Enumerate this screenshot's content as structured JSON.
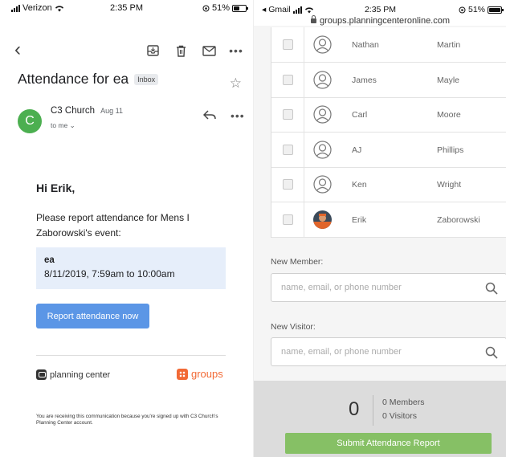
{
  "gmail": {
    "status": {
      "carrier": "Verizon",
      "time": "2:35 PM",
      "battery": "51%"
    },
    "toolbar": {
      "archive_icon": "archive-icon",
      "delete_icon": "trash-icon",
      "mail_icon": "mail-icon",
      "more_icon": "more-icon"
    },
    "subject": "Attendance for ea",
    "label_badge": "Inbox",
    "sender": {
      "initial": "C",
      "name": "C3 Church",
      "date": "Aug 11",
      "to": "to me ⌄",
      "avatar_color": "#4caf50"
    },
    "body": {
      "greeting": "Hi Erik,",
      "message": "Please report attendance for Mens I Zaborowski's event:",
      "event_name": "ea",
      "event_time": "8/11/2019, 7:59am to 10:00am",
      "button": "Report attendance now",
      "button_color": "#5b96e6"
    },
    "footer": {
      "pc_logo": "planning center",
      "groups_logo": "groups",
      "notice": "You are receiving this communication because you're signed up with C3 Church's Planning Center account."
    }
  },
  "pco": {
    "status": {
      "back_app": "◂ Gmail",
      "time": "2:35 PM",
      "battery": "51%",
      "url": "groups.planningcenteronline.com"
    },
    "members": [
      {
        "first": "Nathan",
        "last": "Martin",
        "photo": false
      },
      {
        "first": "James",
        "last": "Mayle",
        "photo": false
      },
      {
        "first": "Carl",
        "last": "Moore",
        "photo": false
      },
      {
        "first": "AJ",
        "last": "Phillips",
        "photo": false
      },
      {
        "first": "Ken",
        "last": "Wright",
        "photo": false
      },
      {
        "first": "Erik",
        "last": "Zaborowski",
        "photo": true
      }
    ],
    "new_member": {
      "label": "New Member:",
      "placeholder": "name, email, or phone number"
    },
    "new_visitor": {
      "label": "New Visitor:",
      "placeholder": "name, email, or phone number"
    },
    "summary": {
      "count": "0",
      "members": "0 Members",
      "visitors": "0 Visitors"
    },
    "submit": "Submit Attendance Report",
    "submit_color": "#86c065"
  }
}
